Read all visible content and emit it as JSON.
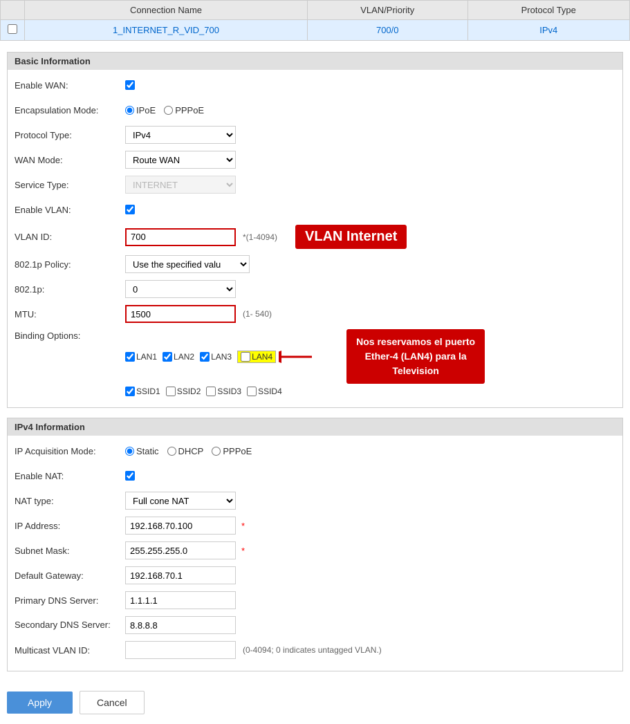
{
  "table": {
    "headers": [
      "Connection Name",
      "VLAN/Priority",
      "Protocol Type"
    ],
    "row": {
      "checkbox": false,
      "connection_name": "1_INTERNET_R_VID_700",
      "vlan_priority": "700/0",
      "protocol_type": "IPv4"
    }
  },
  "basic_info": {
    "section_title": "Basic Information",
    "fields": {
      "enable_wan_label": "Enable WAN:",
      "encap_mode_label": "Encapsulation Mode:",
      "encap_ipoe": "IPoE",
      "encap_pppoe": "PPPoE",
      "protocol_type_label": "Protocol Type:",
      "protocol_type_value": "IPv4",
      "wan_mode_label": "WAN Mode:",
      "wan_mode_value": "Route WAN",
      "service_type_label": "Service Type:",
      "service_type_value": "INTERNET",
      "enable_vlan_label": "Enable VLAN:",
      "vlan_id_label": "VLAN ID:",
      "vlan_id_value": "700",
      "vlan_id_hint": "*(1-4094)",
      "vlan_callout": "VLAN Internet",
      "policy_802_1p_label": "802.1p Policy:",
      "policy_802_1p_value": "Use the specified valu",
      "dot1p_label": "802.1p:",
      "dot1p_value": "0",
      "mtu_label": "MTU:",
      "mtu_value": "1500",
      "mtu_hint": "(1- 540)",
      "binding_label": "Binding Options:",
      "binding_items": [
        {
          "label": "LAN1",
          "checked": true,
          "highlighted": false
        },
        {
          "label": "LAN2",
          "checked": true,
          "highlighted": false
        },
        {
          "label": "LAN3",
          "checked": true,
          "highlighted": false
        },
        {
          "label": "LAN4",
          "checked": false,
          "highlighted": true
        },
        {
          "label": "SSID1",
          "checked": true,
          "highlighted": false
        },
        {
          "label": "SSID2",
          "checked": false,
          "highlighted": false
        },
        {
          "label": "SSID3",
          "checked": false,
          "highlighted": false
        },
        {
          "label": "SSID4",
          "checked": false,
          "highlighted": false
        }
      ],
      "lan4_callout": "Nos reservamos el puerto Ether-4 (LAN4) para la Television"
    }
  },
  "ipv4_info": {
    "section_title": "IPv4 Information",
    "fields": {
      "ip_acq_mode_label": "IP Acquisition Mode:",
      "ip_acq_static": "Static",
      "ip_acq_dhcp": "DHCP",
      "ip_acq_pppoe": "PPPoE",
      "enable_nat_label": "Enable NAT:",
      "nat_type_label": "NAT type:",
      "nat_type_value": "Full cone NAT",
      "ip_address_label": "IP Address:",
      "ip_address_value": "192.168.70.100",
      "subnet_mask_label": "Subnet Mask:",
      "subnet_mask_value": "255.255.255.0",
      "default_gateway_label": "Default Gateway:",
      "default_gateway_value": "192.168.70.1",
      "primary_dns_label": "Primary DNS Server:",
      "primary_dns_value": "1.1.1.1",
      "secondary_dns_label": "Secondary DNS Server:",
      "secondary_dns_value": "8.8.8.8",
      "multicast_vlan_label": "Multicast VLAN ID:",
      "multicast_vlan_value": "",
      "multicast_vlan_hint": "(0-4094; 0 indicates untagged VLAN.)"
    }
  },
  "buttons": {
    "apply": "Apply",
    "cancel": "Cancel"
  }
}
